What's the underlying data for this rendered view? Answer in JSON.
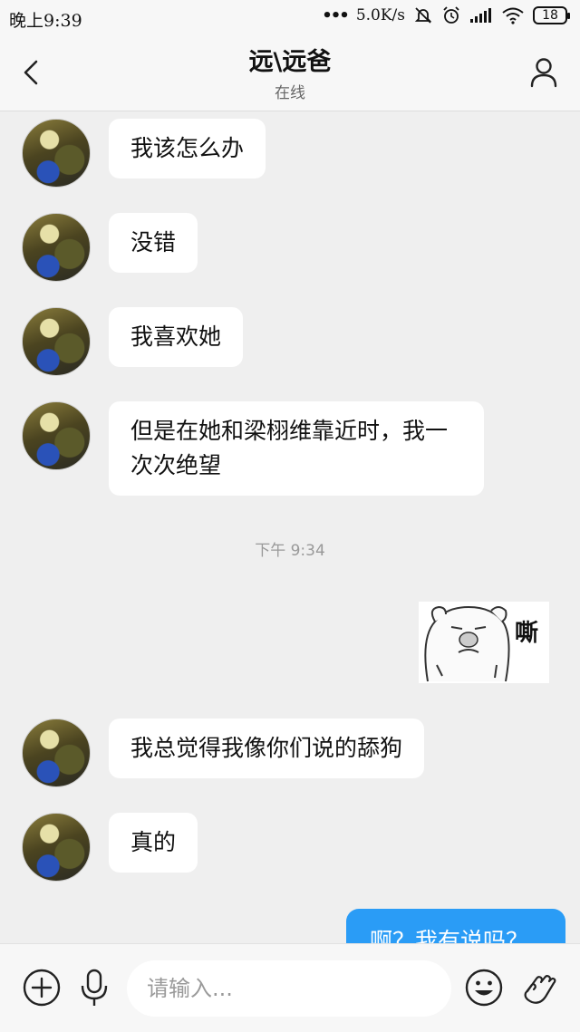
{
  "status_bar": {
    "time": "晚上9:39",
    "net_speed": "5.0K/s",
    "battery": "18"
  },
  "header": {
    "title": "远\\远爸",
    "subtitle": "在线"
  },
  "messages": [
    {
      "text": "我该怎么办"
    },
    {
      "text": "没错"
    },
    {
      "text": "我喜欢她"
    },
    {
      "text": "但是在她和梁栩维靠近时，我一次次绝望"
    },
    {
      "text": "我总觉得我像你们说的舔狗"
    },
    {
      "text": "真的"
    }
  ],
  "timestamp": "下午 9:34",
  "sticker": {
    "caption": "嘶"
  },
  "outgoing_message": "啊？我有说吗？",
  "input": {
    "placeholder": "请输入..."
  },
  "icons": {
    "back": "chevron-left-icon",
    "profile": "person-icon",
    "plus": "plus-circle-icon",
    "mic": "microphone-icon",
    "emoji": "smiley-icon",
    "gesture": "waving-hand-icon"
  },
  "colors": {
    "accent": "#2a9cf6",
    "background": "#efefef",
    "bubble": "#ffffff"
  }
}
